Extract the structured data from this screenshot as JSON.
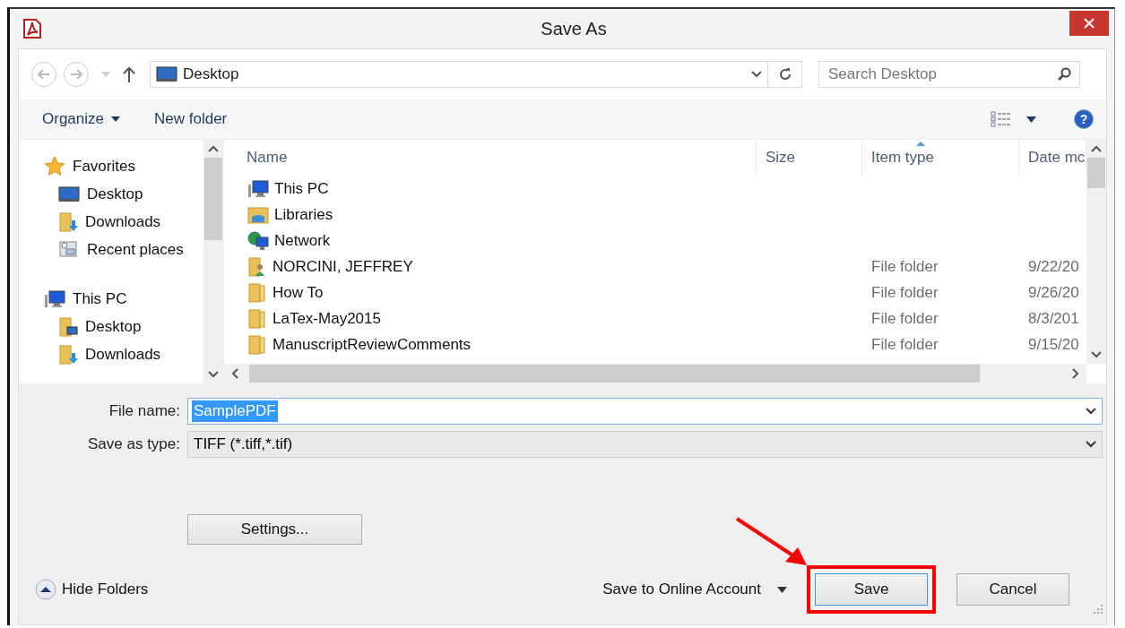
{
  "window": {
    "title": "Save As"
  },
  "address_bar": {
    "location": "Desktop"
  },
  "search": {
    "placeholder": "Search Desktop"
  },
  "toolbar": {
    "organize": "Organize",
    "new_folder": "New folder",
    "help": "?"
  },
  "nav_pane": {
    "items": [
      {
        "label": "Favorites",
        "kind": "favorites",
        "children": [
          {
            "label": "Desktop",
            "kind": "desktop"
          },
          {
            "label": "Downloads",
            "kind": "downloads"
          },
          {
            "label": "Recent places",
            "kind": "recent"
          }
        ]
      },
      {
        "label": "This PC",
        "kind": "computer",
        "children": [
          {
            "label": "Desktop",
            "kind": "desktop-folder"
          },
          {
            "label": "Downloads",
            "kind": "downloads"
          }
        ]
      }
    ]
  },
  "file_list": {
    "columns": [
      {
        "label": "Name",
        "sorted": false
      },
      {
        "label": "Size",
        "sorted": false
      },
      {
        "label": "Item type",
        "sorted": true
      },
      {
        "label": "Date mc",
        "sorted": false
      }
    ],
    "rows": [
      {
        "name": "This PC",
        "kind": "computer"
      },
      {
        "name": "Libraries",
        "kind": "libraries"
      },
      {
        "name": "Network",
        "kind": "network"
      },
      {
        "name": "NORCINI, JEFFREY",
        "kind": "user-folder",
        "item_type": "File folder",
        "date": "9/22/20"
      },
      {
        "name": "How To",
        "kind": "folder",
        "item_type": "File folder",
        "date": "9/26/20"
      },
      {
        "name": "LaTex-May2015",
        "kind": "folder",
        "item_type": "File folder",
        "date": "8/3/201"
      },
      {
        "name": "ManuscriptReviewComments",
        "kind": "folder",
        "item_type": "File folder",
        "date": "9/15/20"
      }
    ]
  },
  "file_name": {
    "label": "File name:",
    "value": "SamplePDF",
    "selected": true
  },
  "save_as_type": {
    "label": "Save as type:",
    "value": "TIFF (*.tiff,*.tif)"
  },
  "settings_button": "Settings...",
  "hide_folders": "Hide Folders",
  "online_account": "Save to Online Account",
  "buttons": [
    {
      "label": "Save",
      "kind": "primary",
      "highlighted": true
    },
    {
      "label": "Cancel",
      "kind": "secondary",
      "highlighted": false
    }
  ]
}
